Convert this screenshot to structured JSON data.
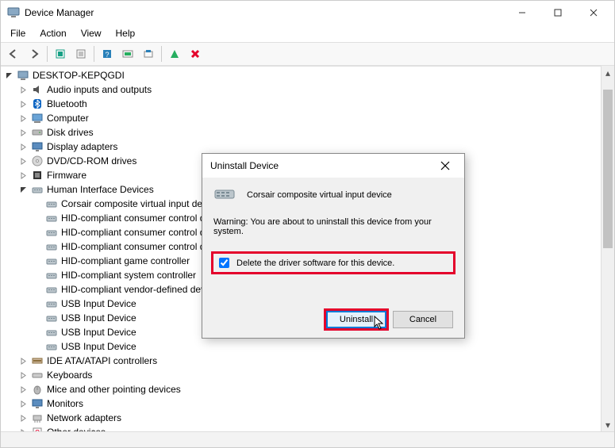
{
  "window": {
    "title": "Device Manager"
  },
  "menu": {
    "file": "File",
    "action": "Action",
    "view": "View",
    "help": "Help"
  },
  "tree": {
    "root": "DESKTOP-KEPQGDI",
    "items": [
      "Audio inputs and outputs",
      "Bluetooth",
      "Computer",
      "Disk drives",
      "Display adapters",
      "DVD/CD-ROM drives",
      "Firmware"
    ],
    "hid_label": "Human Interface Devices",
    "hid_children": [
      "Corsair composite virtual input device",
      "HID-compliant consumer control device",
      "HID-compliant consumer control device",
      "HID-compliant consumer control device",
      "HID-compliant game controller",
      "HID-compliant system controller",
      "HID-compliant vendor-defined device",
      "USB Input Device",
      "USB Input Device",
      "USB Input Device",
      "USB Input Device"
    ],
    "rest": [
      "IDE ATA/ATAPI controllers",
      "Keyboards",
      "Mice and other pointing devices",
      "Monitors",
      "Network adapters",
      "Other devices"
    ]
  },
  "dialog": {
    "title": "Uninstall Device",
    "device_name": "Corsair composite virtual input device",
    "warning": "Warning: You are about to uninstall this device from your system.",
    "checkbox_label": "Delete the driver software for this device.",
    "uninstall": "Uninstall",
    "cancel": "Cancel"
  }
}
